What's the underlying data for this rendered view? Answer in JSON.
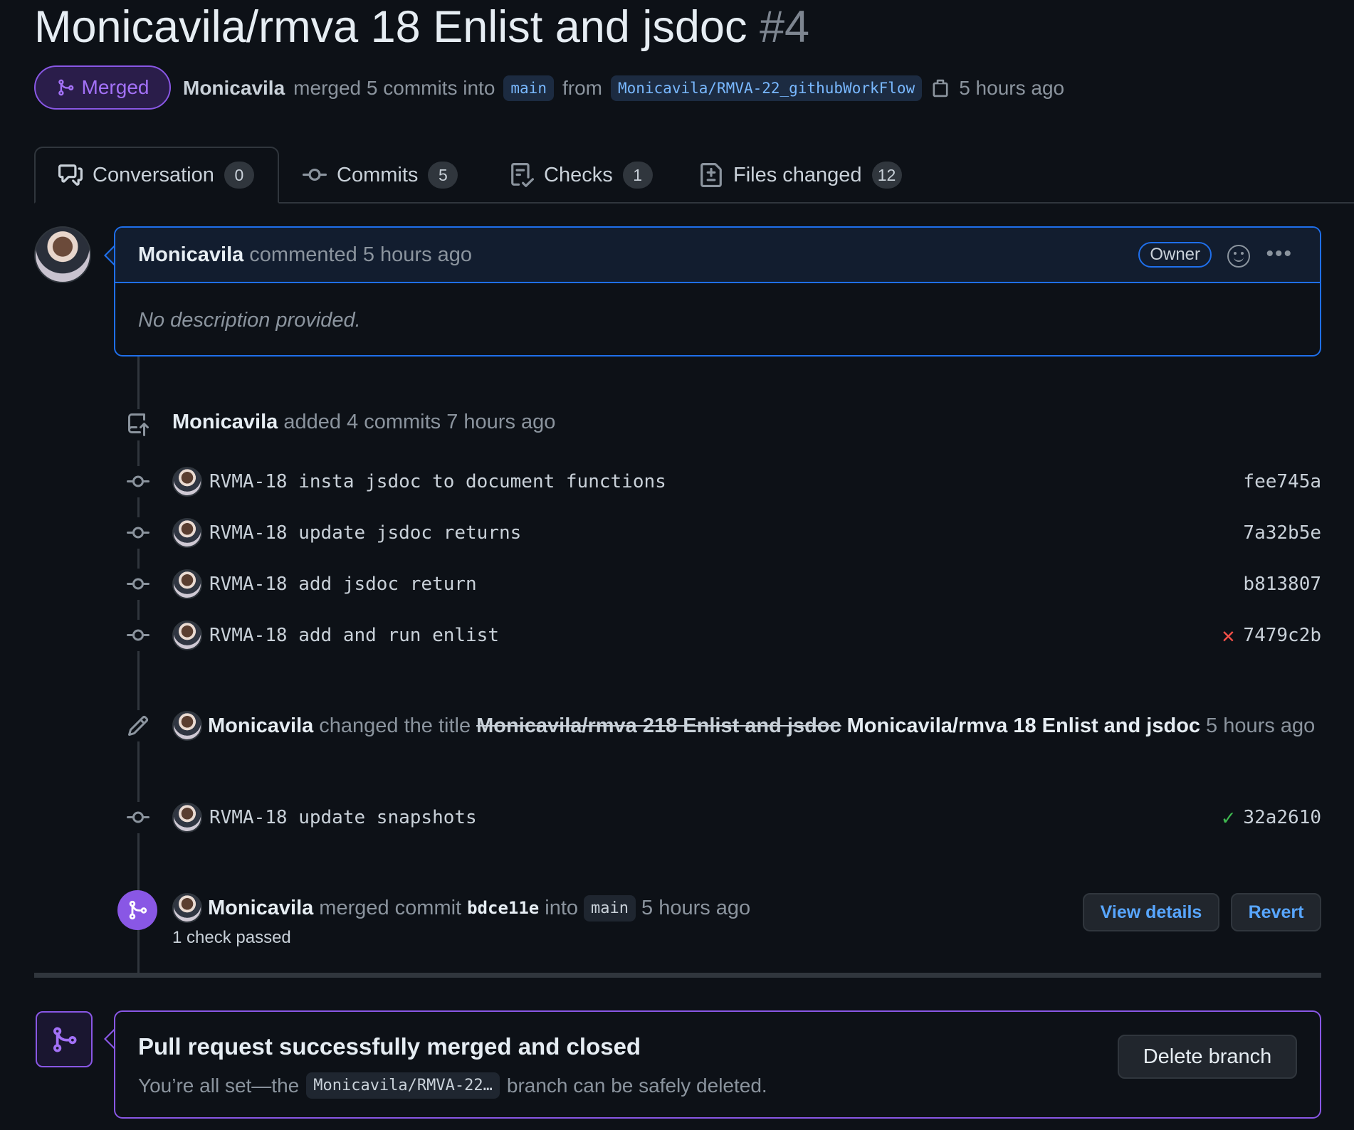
{
  "pr": {
    "title": "Monicavila/rmva 18 Enlist and jsdoc",
    "number": "#4",
    "state": "Merged",
    "author": "Monicavila",
    "merge_text": "merged 5 commits into",
    "base_branch": "main",
    "from_text": "from",
    "head_branch": "Monicavila/RMVA-22_githubWorkFlow",
    "time": "5 hours ago"
  },
  "tabs": [
    {
      "label": "Conversation",
      "count": "0",
      "icon": "comment-discussion-icon"
    },
    {
      "label": "Commits",
      "count": "5",
      "icon": "git-commit-icon"
    },
    {
      "label": "Checks",
      "count": "1",
      "icon": "checklist-icon"
    },
    {
      "label": "Files changed",
      "count": "12",
      "icon": "file-diff-icon"
    }
  ],
  "comment": {
    "author": "Monicavila",
    "action": "commented 5 hours ago",
    "badge": "Owner",
    "body": "No description provided."
  },
  "commits_event": {
    "author": "Monicavila",
    "action": "added 4 commits 7 hours ago"
  },
  "commits": [
    {
      "message": "RVMA-18 insta jsdoc to document functions",
      "sha": "fee745a"
    },
    {
      "message": "RVMA-18 update jsdoc returns",
      "sha": "7a32b5e"
    },
    {
      "message": "RVMA-18 add jsdoc return",
      "sha": "b813807"
    },
    {
      "message": "RVMA-18 add and run enlist",
      "sha": "7479c2b",
      "status": "failure"
    }
  ],
  "title_change": {
    "author": "Monicavila",
    "action": "changed the title",
    "old_title": "Monicavila/rmva 218 Enlist and jsdoc",
    "new_title": "Monicavila/rmva 18 Enlist and jsdoc",
    "time": "5 hours ago"
  },
  "last_commit": {
    "message": "RVMA-18 update snapshots",
    "sha": "32a2610",
    "status": "success"
  },
  "merge_event": {
    "author": "Monicavila",
    "action": "merged commit",
    "commit": "bdce11e",
    "into": "into",
    "branch": "main",
    "time": "5 hours ago",
    "checks": "1 check passed",
    "view_details": "View details",
    "revert": "Revert"
  },
  "merge_box": {
    "title": "Pull request successfully merged and closed",
    "desc_prefix": "You’re all set—the",
    "branch": "Monicavila/RMVA-22…",
    "desc_suffix": "branch can be safely deleted.",
    "delete_button": "Delete branch"
  },
  "colors": {
    "background": "#0d1117",
    "merged_purple": "#8957e5",
    "link_blue": "#58a6ff",
    "failure_red": "#f85149",
    "success_green": "#3fb950"
  }
}
